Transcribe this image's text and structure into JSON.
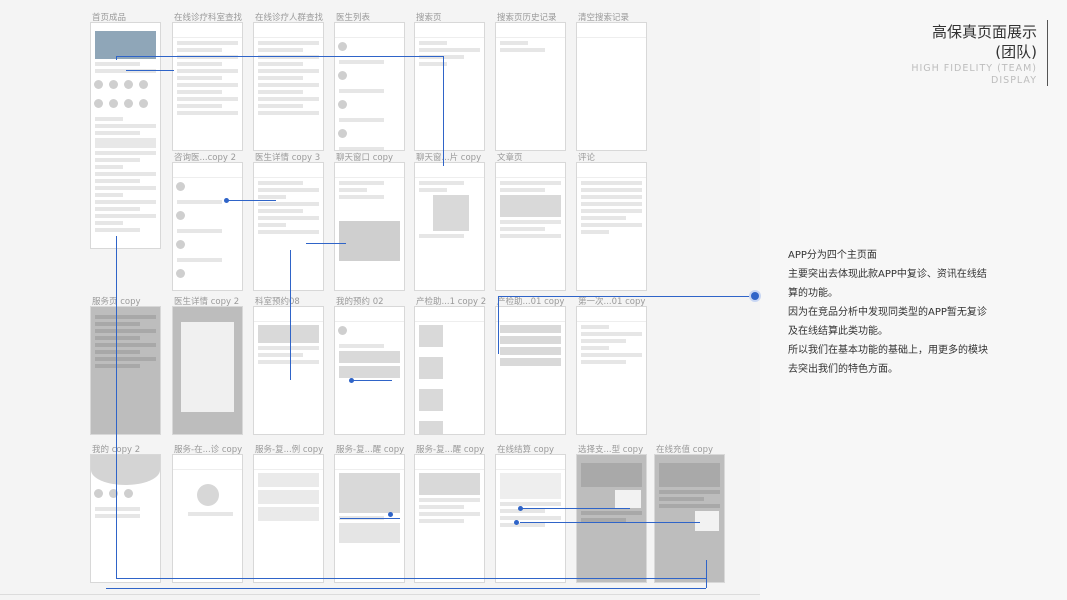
{
  "header": {
    "title_zh_line1": "高保真页面展示",
    "title_zh_line2": "(团队)",
    "title_en_line1": "HIGH FIDELITY (TEAM)",
    "title_en_line2": "DISPLAY"
  },
  "description": [
    "APP分为四个主页面",
    "主要突出去体现此款APP中复诊、资讯在线结算的功能。",
    "因为在竞品分析中发现同类型的APP暂无复诊及在线结算此类功能。",
    "所以我们在基本功能的基础上，用更多的模块去突出我们的特色方面。"
  ],
  "screens": [
    {
      "label": "首页成品"
    },
    {
      "label": "在线诊疗科室查找"
    },
    {
      "label": "在线诊疗人群查找"
    },
    {
      "label": "医生列表"
    },
    {
      "label": "搜索页"
    },
    {
      "label": "搜索页历史记录"
    },
    {
      "label": "清空搜索记录"
    },
    {
      "label": "咨询医...copy 2"
    },
    {
      "label": "医生详情 copy 3"
    },
    {
      "label": "聊天窗口 copy"
    },
    {
      "label": "聊天窗...片 copy"
    },
    {
      "label": "文章页"
    },
    {
      "label": "评论"
    },
    {
      "label": "服务页 copy"
    },
    {
      "label": "医生详情 copy 2"
    },
    {
      "label": "科室预约08"
    },
    {
      "label": "我的预约 02"
    },
    {
      "label": "产检助...1 copy 2"
    },
    {
      "label": "产检助...01 copy"
    },
    {
      "label": "第一次...01 copy"
    },
    {
      "label": "我的 copy 2"
    },
    {
      "label": "服务-在...诊 copy"
    },
    {
      "label": "服务-复...例 copy"
    },
    {
      "label": "服务-复...醒 copy"
    },
    {
      "label": "服务-复...醒 copy"
    },
    {
      "label": "在线结算 copy"
    },
    {
      "label": "选择支...型 copy"
    },
    {
      "label": "在线充值 copy"
    }
  ]
}
